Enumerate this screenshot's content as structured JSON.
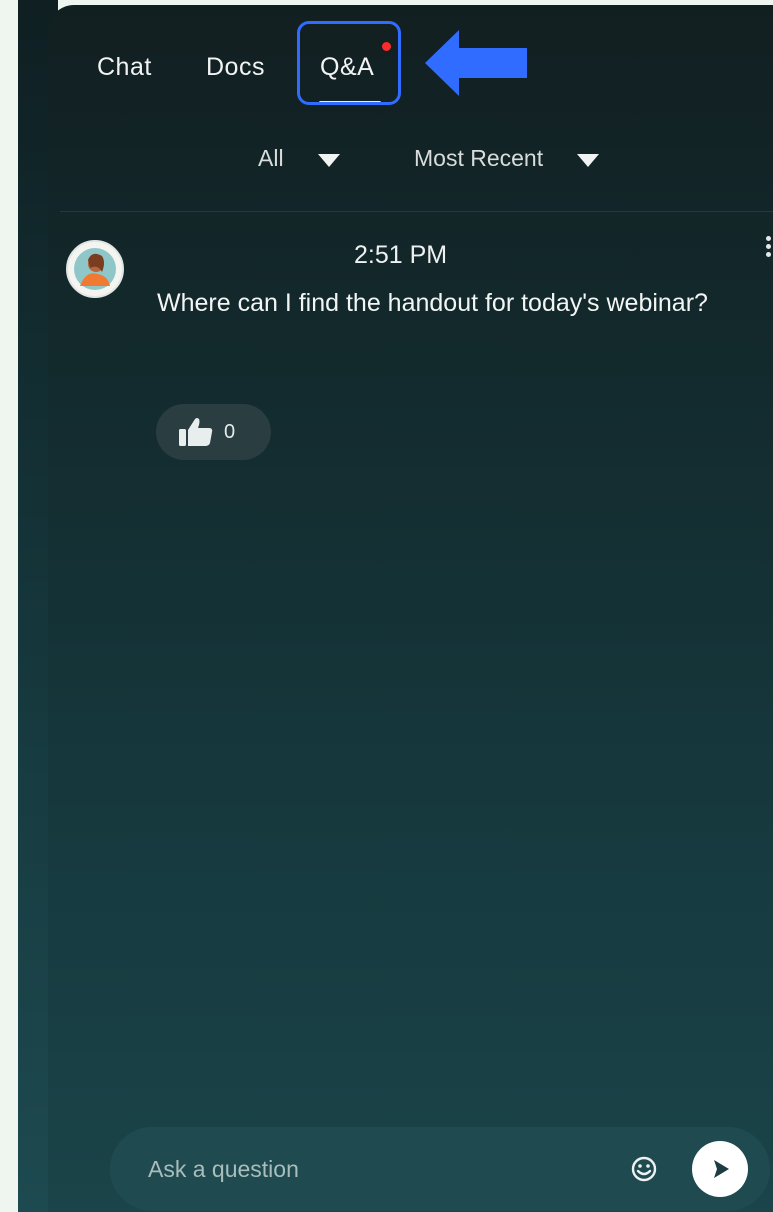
{
  "tabs": [
    {
      "label": "Chat"
    },
    {
      "label": "Docs"
    },
    {
      "label": "Q&A"
    }
  ],
  "filters": {
    "scope": "All",
    "sort": "Most Recent"
  },
  "message": {
    "time": "2:51 PM",
    "text": "Where can I find the handout for today's webinar?",
    "likes": "0"
  },
  "composer": {
    "placeholder": "Ask a question"
  },
  "colors": {
    "highlight": "#2f6cff",
    "notification": "#ff2b2b"
  },
  "icons": [
    "thumbs-up-icon",
    "emoji-icon",
    "send-icon",
    "more-vertical-icon",
    "left-arrow-icon"
  ]
}
